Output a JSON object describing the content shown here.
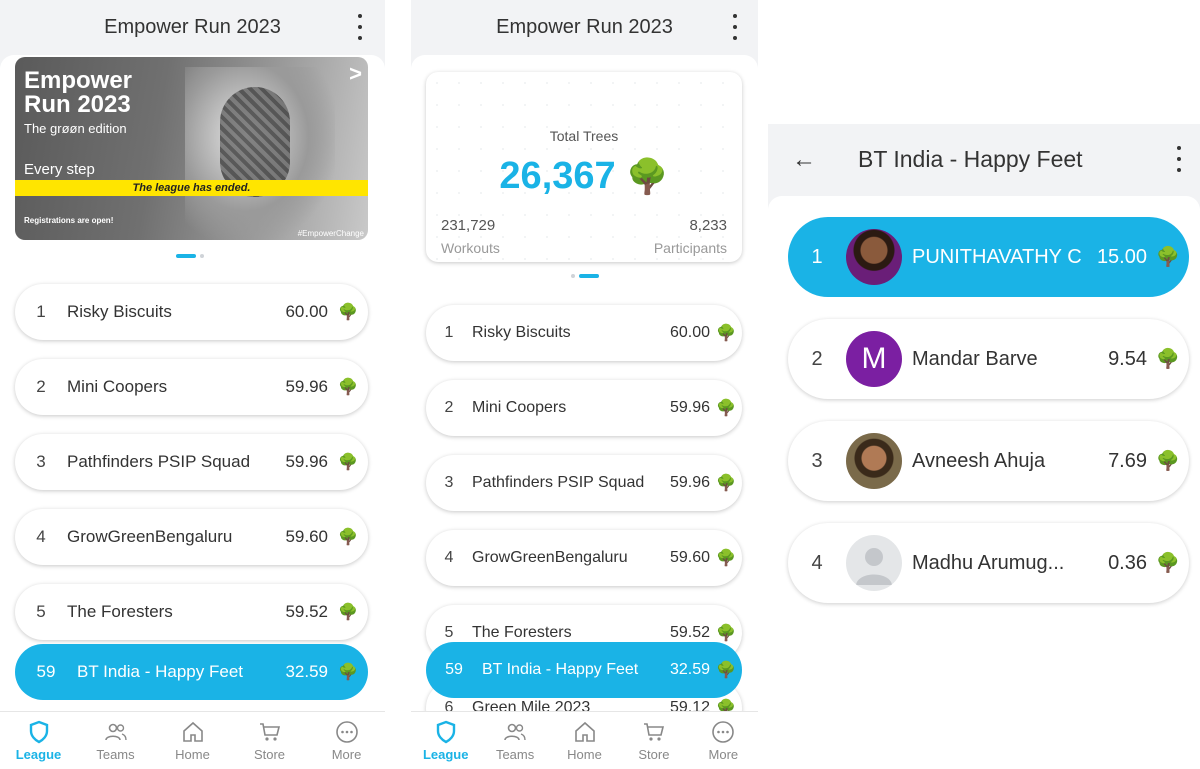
{
  "league": {
    "title": "Empower Run 2023",
    "banner": {
      "title_line1": "Empower",
      "title_line2": "Run 2023",
      "edition": "The grøøn edition",
      "every_step": "Every step",
      "ended": "The league has ended.",
      "registrations": "Registrations are open!",
      "hashtag": "#EmpowerChange",
      "chevron": ">"
    },
    "teams": [
      {
        "rank": "1",
        "name": "Risky Biscuits",
        "score": "60.00"
      },
      {
        "rank": "2",
        "name": "Mini Coopers",
        "score": "59.96"
      },
      {
        "rank": "3",
        "name": "Pathfinders PSIP Squad",
        "score": "59.96"
      },
      {
        "rank": "4",
        "name": "GrowGreenBengaluru",
        "score": "59.60"
      },
      {
        "rank": "5",
        "name": "The Foresters",
        "score": "59.52"
      }
    ],
    "my_team": {
      "rank": "59",
      "name": "BT India - Happy Feet",
      "score": "32.59"
    }
  },
  "stats": {
    "title": "Empower Run 2023",
    "total_label": "Total Trees",
    "total_value": "26,367",
    "workouts_value": "231,729",
    "workouts_label": "Workouts",
    "participants_value": "8,233",
    "participants_label": "Participants",
    "teams": [
      {
        "rank": "1",
        "name": "Risky Biscuits",
        "score": "60.00"
      },
      {
        "rank": "2",
        "name": "Mini Coopers",
        "score": "59.96"
      },
      {
        "rank": "3",
        "name": "Pathfinders PSIP Squad",
        "score": "59.96"
      },
      {
        "rank": "4",
        "name": "GrowGreenBengaluru",
        "score": "59.60"
      },
      {
        "rank": "5",
        "name": "The Foresters",
        "score": "59.52"
      },
      {
        "rank": "6",
        "name": "Green Mile 2023",
        "score": "59.12"
      }
    ],
    "my_team": {
      "rank": "59",
      "name": "BT India - Happy Feet",
      "score": "32.59"
    }
  },
  "team_view": {
    "title": "BT India - Happy Feet",
    "back": "←",
    "members": [
      {
        "rank": "1",
        "name": "PUNITHAVATHY C",
        "score": "15.00",
        "avatar": "photo"
      },
      {
        "rank": "2",
        "name": "Mandar Barve",
        "score": "9.54",
        "avatar": "M"
      },
      {
        "rank": "3",
        "name": "Avneesh Ahuja",
        "score": "7.69",
        "avatar": "photo"
      },
      {
        "rank": "4",
        "name": "Madhu Arumug...",
        "score": "0.36",
        "avatar": "placeholder"
      }
    ]
  },
  "tree_icon": "🌳",
  "nav": [
    {
      "label": "League",
      "icon": "shield-icon"
    },
    {
      "label": "Teams",
      "icon": "people-icon"
    },
    {
      "label": "Home",
      "icon": "home-icon"
    },
    {
      "label": "Store",
      "icon": "cart-icon"
    },
    {
      "label": "More",
      "icon": "more-icon"
    }
  ],
  "colors": {
    "accent": "#1ab3e6",
    "banner_strip": "#ffe500",
    "avatar_m": "#7b1fa2"
  }
}
